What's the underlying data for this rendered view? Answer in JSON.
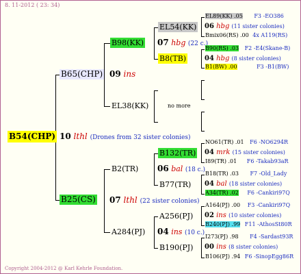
{
  "header": "8. 11-2012 ( 23: 34)",
  "footer": "Copyright 2004-2012 @ Karl Kehrle Foundation.",
  "root": {
    "label": "B54(CHP)",
    "gen_num": "10",
    "gen_term": "lthl",
    "note": "(Drones from 32 sister colonies)"
  },
  "upper": {
    "parent": {
      "label": "B65(CHP)",
      "gen_num": "09",
      "gen_term": "ins"
    },
    "a": {
      "label": "B98(KK)",
      "gen_num": "07",
      "gen_term": "hbg",
      "note": "(22 c.)",
      "b1": {
        "label": "EL54(KK)",
        "gen_num": "06",
        "gen_term": "hbg",
        "note": "(11 sister colonies)",
        "c1": {
          "label": "EL89(KK) .05",
          "id": "F3 -EO386"
        },
        "c2": {
          "label": "Bmix06(RS) .00",
          "id": "4x A119(RS)"
        }
      },
      "b2": {
        "label": "B8(TB)",
        "gen_num": "04",
        "gen_term": "hbg",
        "note": "(8 sister colonies)",
        "c1": {
          "label": "B90(RS) .03",
          "id": "F2 -E4(Skane-B)"
        },
        "c2": {
          "label": "B1(BW) .00",
          "id": "F3 -B1(BW)"
        }
      }
    },
    "b": {
      "label": "EL38(KK)",
      "note": "no more"
    }
  },
  "lower": {
    "parent": {
      "label": "B25(CS)",
      "gen_num": "07",
      "gen_term": "lthl",
      "note": "(22 sister colonies)"
    },
    "a": {
      "label": "B2(TR)",
      "gen_num": "06",
      "gen_term": "bal",
      "note": "(18 c.)",
      "b1": {
        "label": "B132(TR)",
        "gen_num": "04",
        "gen_term": "mrk",
        "note": "(15 sister colonies)",
        "c1": {
          "label": "NO61(TR) .01",
          "id": "F6 -NO6294R"
        },
        "c2": {
          "label": "I89(TR) .01",
          "id": "F6 -Takab93aR"
        }
      },
      "b2": {
        "label": "B77(TR)",
        "gen_num": "04",
        "gen_term": "bal",
        "note": "(18 sister colonies)",
        "c1": {
          "label": "B18(TR) .03",
          "id": "F7 -Old_Lady"
        },
        "c2": {
          "label": "A34(TR) .02",
          "id": "F6 -Cankiri97Q"
        }
      }
    },
    "b": {
      "label": "A284(PJ)",
      "gen_num": "04",
      "gen_term": "ins",
      "note": "(10 c.)",
      "b1": {
        "label": "A256(PJ)",
        "gen_num": "02",
        "gen_term": "ins",
        "note": "(10 sister colonies)",
        "c1": {
          "label": "A164(PJ) .00",
          "id": "F3 -Cankiri97Q"
        },
        "c2": {
          "label": "B240(PJ) .99",
          "id": "F11 -AthosSt80R"
        }
      },
      "b2": {
        "label": "B190(PJ)",
        "gen_num": "00",
        "gen_term": "ins",
        "note": "(8 sister colonies)",
        "c1": {
          "label": "I273(PJ) .98",
          "id": "F4 -Sardast93R"
        },
        "c2": {
          "label": "B106(PJ) .94",
          "id": "F6 -SinopEgg86R"
        }
      }
    }
  }
}
